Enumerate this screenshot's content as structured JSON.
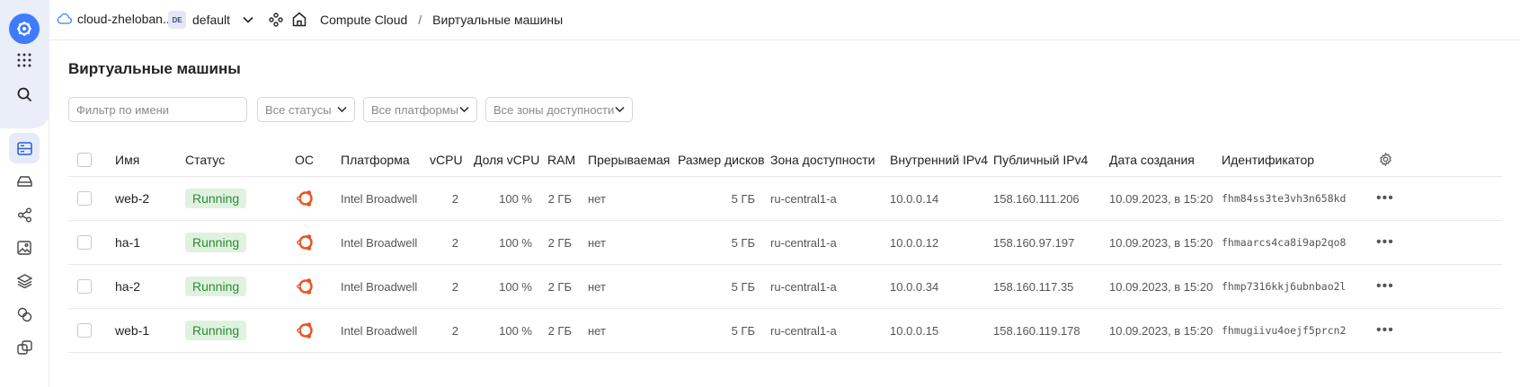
{
  "topbar": {
    "cloud_name": "cloud-zheloban...",
    "folder_badge": "DE",
    "folder_name": "default",
    "breadcrumb": [
      "Compute Cloud",
      "/",
      "Виртуальные машины"
    ]
  },
  "page": {
    "title": "Виртуальные машины"
  },
  "filters": {
    "name_placeholder": "Фильтр по имени",
    "status": "Все статусы",
    "platform": "Все платформы",
    "zone": "Все зоны доступности"
  },
  "table": {
    "columns": [
      "Имя",
      "Статус",
      "ОС",
      "Платформа",
      "vCPU",
      "Доля vCPU",
      "RAM",
      "Прерываемая",
      "Размер дисков",
      "Зона доступности",
      "Внутренний IPv4",
      "Публичный IPv4",
      "Дата создания",
      "Идентификатор"
    ],
    "rows": [
      {
        "name": "web-2",
        "status": "Running",
        "platform": "Intel Broadwell",
        "vcpu": "2",
        "vcpu_share": "100 %",
        "ram": "2 ГБ",
        "preemptible": "нет",
        "disk": "5 ГБ",
        "zone": "ru-central1-a",
        "internal_ip": "10.0.0.14",
        "public_ip": "158.160.111.206",
        "created": "10.09.2023, в 15:20",
        "id": "fhm84ss3te3vh3n658kd"
      },
      {
        "name": "ha-1",
        "status": "Running",
        "platform": "Intel Broadwell",
        "vcpu": "2",
        "vcpu_share": "100 %",
        "ram": "2 ГБ",
        "preemptible": "нет",
        "disk": "5 ГБ",
        "zone": "ru-central1-a",
        "internal_ip": "10.0.0.12",
        "public_ip": "158.160.97.197",
        "created": "10.09.2023, в 15:20",
        "id": "fhmaarcs4ca8i9ap2qo8"
      },
      {
        "name": "ha-2",
        "status": "Running",
        "platform": "Intel Broadwell",
        "vcpu": "2",
        "vcpu_share": "100 %",
        "ram": "2 ГБ",
        "preemptible": "нет",
        "disk": "5 ГБ",
        "zone": "ru-central1-a",
        "internal_ip": "10.0.0.34",
        "public_ip": "158.160.117.35",
        "created": "10.09.2023, в 15:20",
        "id": "fhmp7316kkj6ubnbao2l"
      },
      {
        "name": "web-1",
        "status": "Running",
        "platform": "Intel Broadwell",
        "vcpu": "2",
        "vcpu_share": "100 %",
        "ram": "2 ГБ",
        "preemptible": "нет",
        "disk": "5 ГБ",
        "zone": "ru-central1-a",
        "internal_ip": "10.0.0.15",
        "public_ip": "158.160.119.178",
        "created": "10.09.2023, в 15:20",
        "id": "fhmugiivu4oejf5prcn2"
      }
    ],
    "row_menu": "•••"
  },
  "colors": {
    "accent": "#3e7bff",
    "status_running_bg": "#dff2df",
    "status_running_text": "#2e8a33",
    "ubuntu": "#e95420"
  },
  "icons": {
    "rail": [
      "yandex-cloud-logo-icon",
      "apps-grid-icon",
      "search-icon",
      "server-icon",
      "disk-icon",
      "network-icon",
      "image-icon",
      "layers-icon",
      "snapshot-icon",
      "group-icon"
    ],
    "os": "ubuntu-icon"
  }
}
